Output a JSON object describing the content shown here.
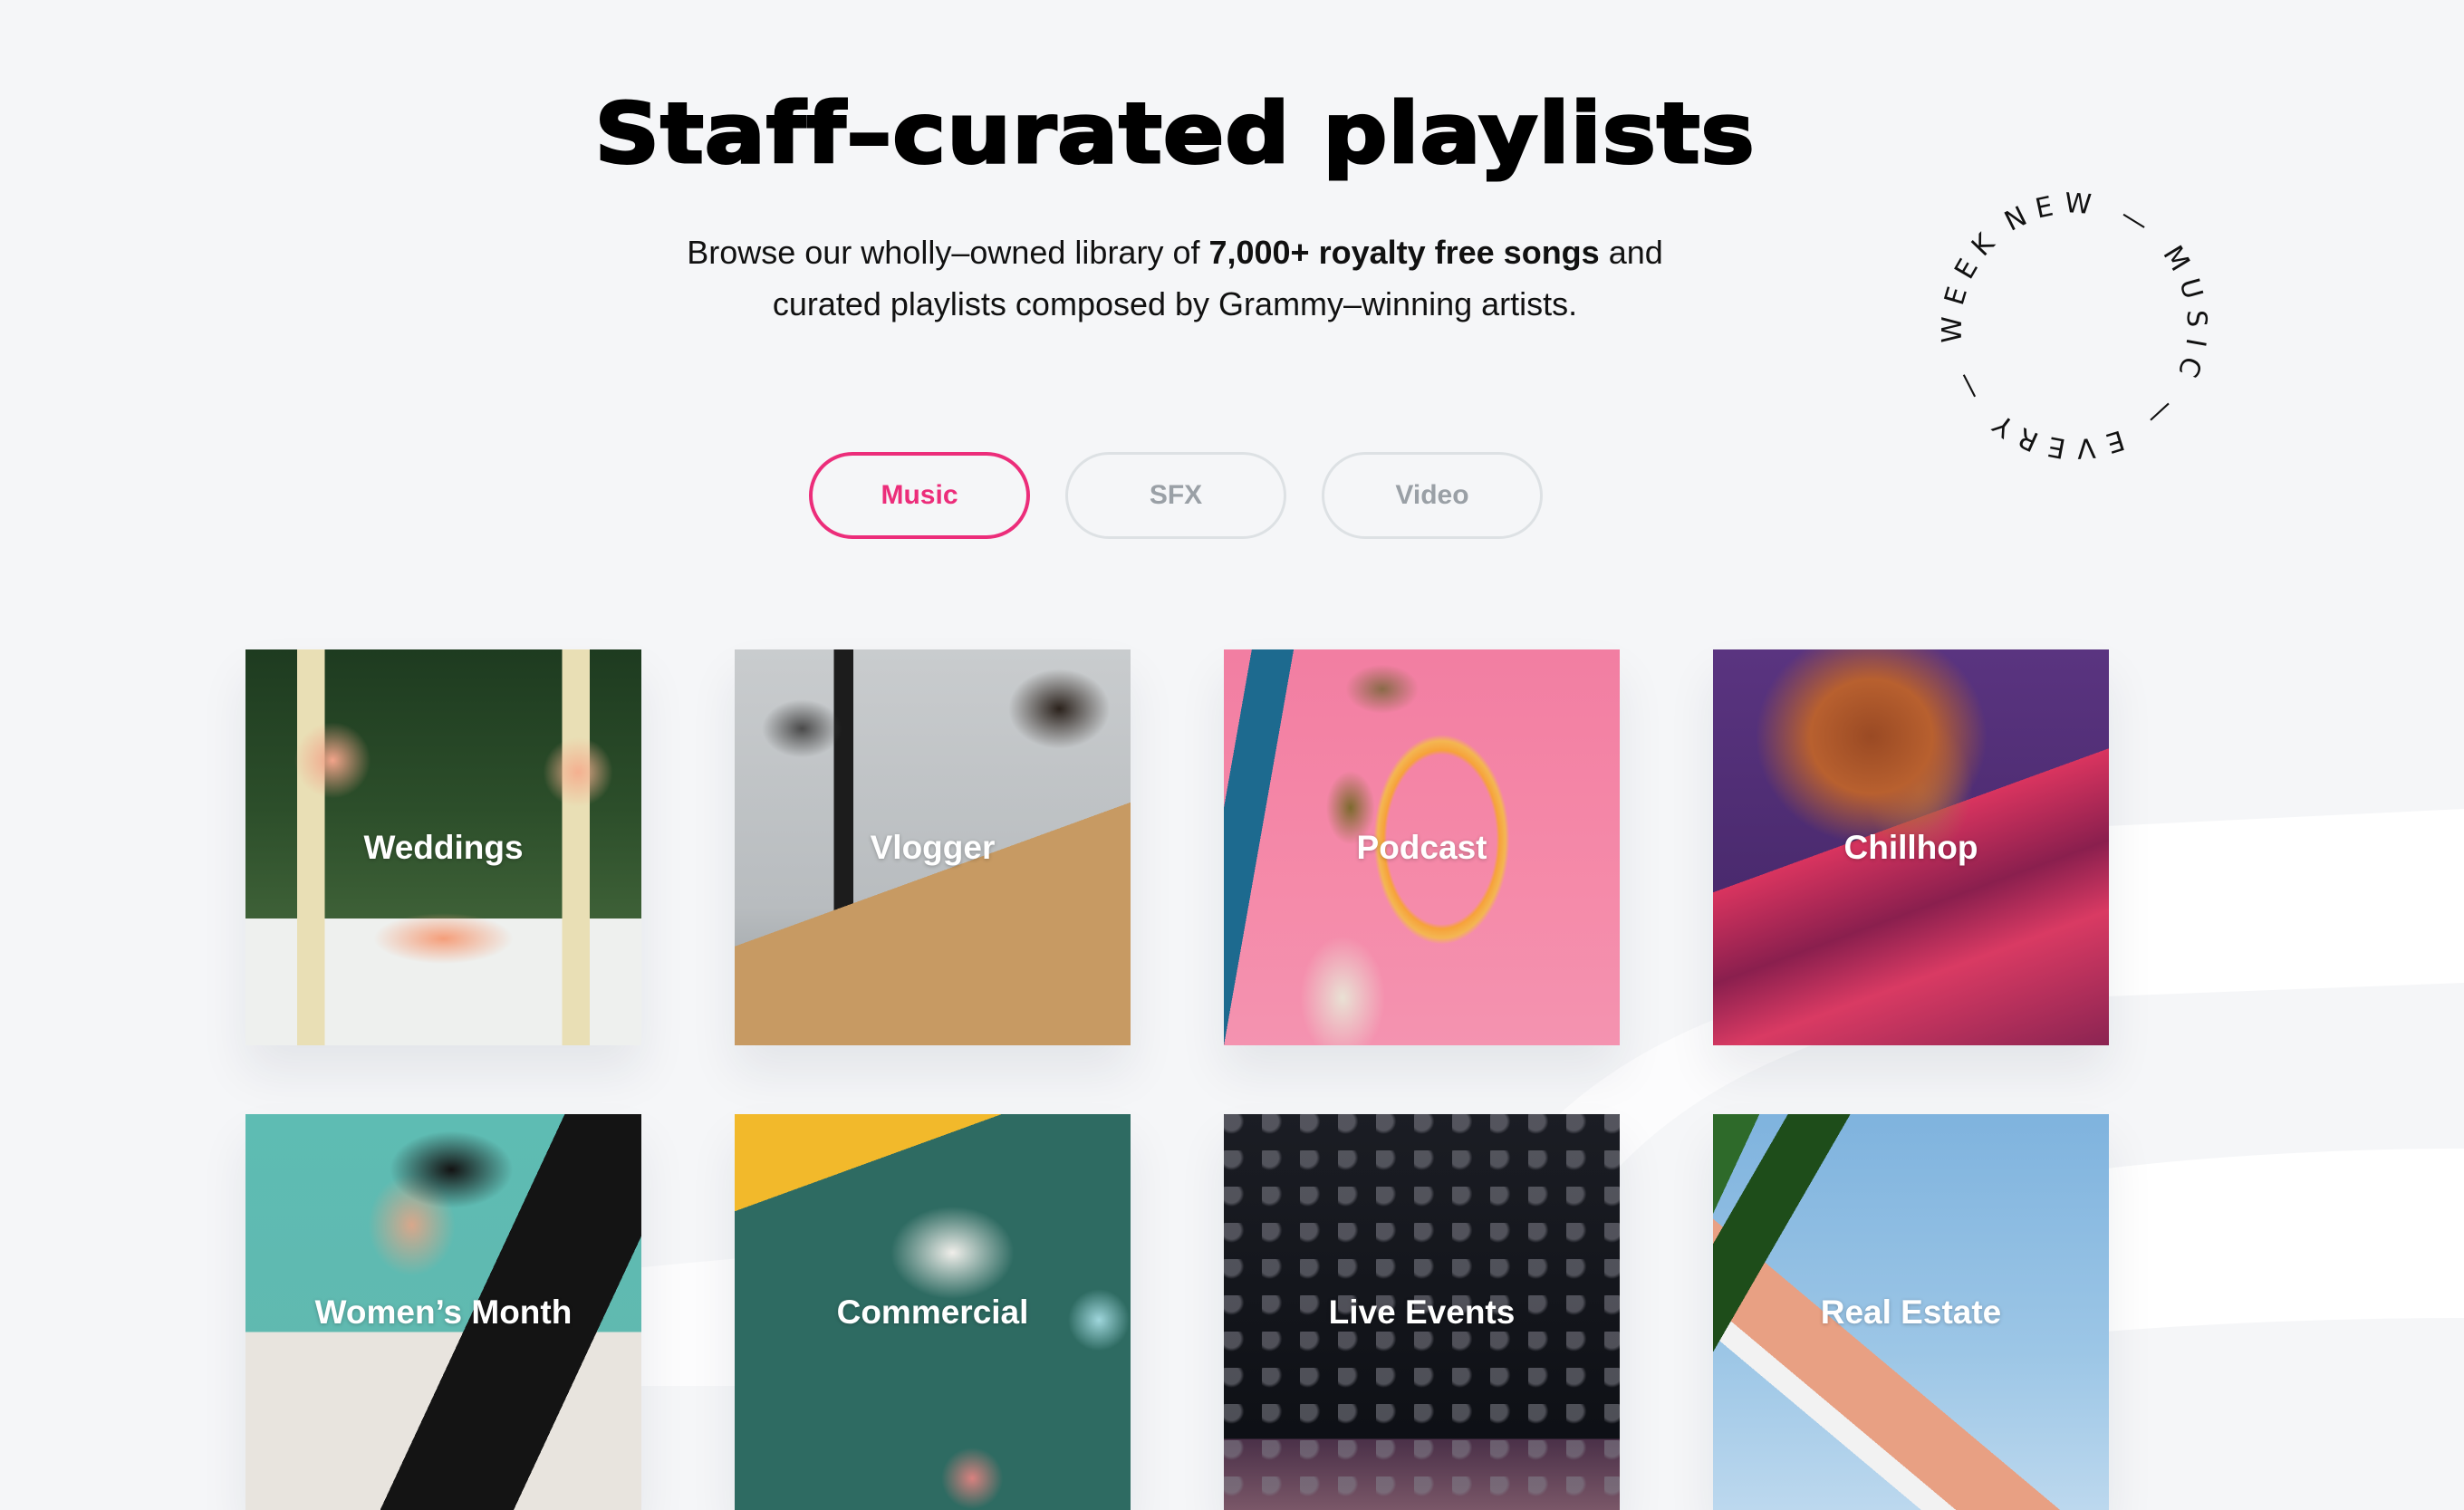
{
  "header": {
    "title": "Staff–curated playlists",
    "subtitle_line1_prefix": "Browse our wholly–owned library of ",
    "subtitle_line1_bold": "7,000+ royalty free songs",
    "subtitle_line1_suffix": " and",
    "subtitle_line2": "curated playlists composed by Grammy–winning artists."
  },
  "badge": {
    "circular_text": "NEW — MUSIC — EVERY — WEEK — "
  },
  "tabs": [
    {
      "label": "Music",
      "active": true
    },
    {
      "label": "SFX",
      "active": false
    },
    {
      "label": "Video",
      "active": false
    }
  ],
  "playlists": [
    {
      "label": "Weddings",
      "image": "wedding-arch-photo"
    },
    {
      "label": "Vlogger",
      "image": "man-with-camera-gimbal-photo"
    },
    {
      "label": "Podcast",
      "image": "pink-chair-beach-photo"
    },
    {
      "label": "Chillhop",
      "image": "woman-tie-dye-sweater-photo"
    },
    {
      "label": "Women’s Month",
      "image": "laughing-woman-cap-photo"
    },
    {
      "label": "Commercial",
      "image": "slippers-tropical-photo"
    },
    {
      "label": "Live Events",
      "image": "concert-crowd-photo"
    },
    {
      "label": "Real Estate",
      "image": "palm-building-photo"
    }
  ],
  "colors": {
    "accent": "#EC2D7A",
    "background": "#F5F6F8",
    "tab_inactive_border": "#DDE1E4",
    "tab_inactive_text": "#9AA0A6"
  }
}
